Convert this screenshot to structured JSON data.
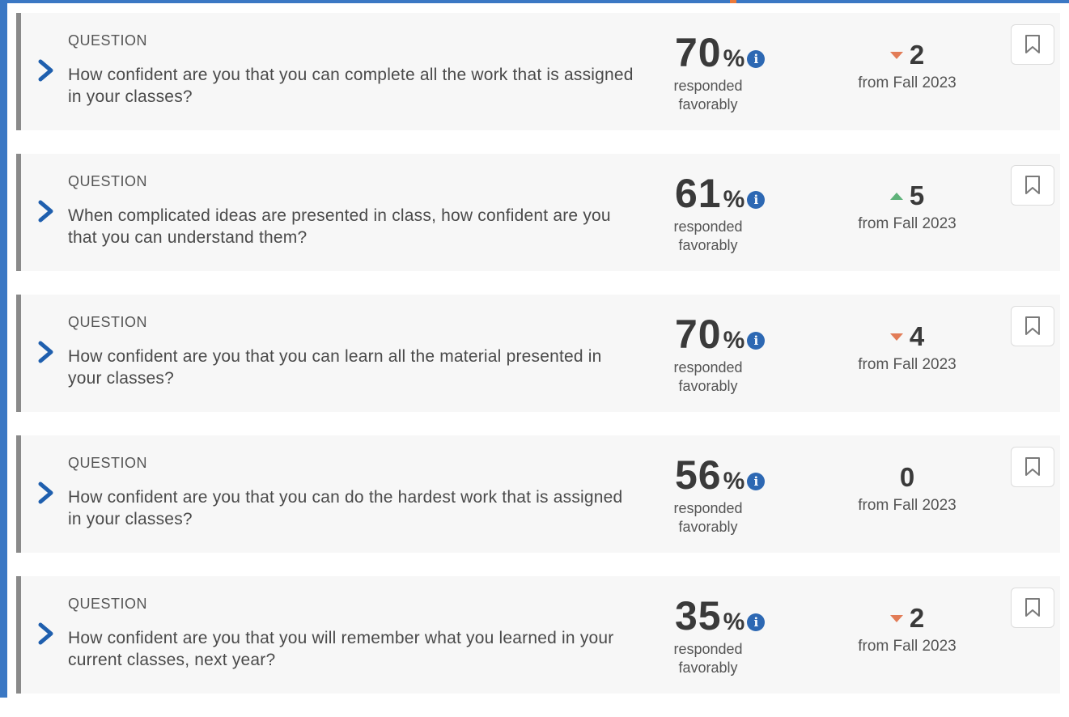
{
  "colors": {
    "frame_blue": "#3b78c4",
    "accent_orange": "#ec7a3a",
    "down": "#e27c57",
    "up": "#5fb27a",
    "info": "#2d68b3"
  },
  "icons": {
    "expand": "chevron-right-icon",
    "info": "info-icon",
    "bookmark": "bookmark-icon",
    "trend_down": "triangle-down-icon",
    "trend_up": "triangle-up-icon"
  },
  "questions": [
    {
      "label": "QUESTION",
      "text": "How confident are you that you can complete all the work that is assigned in your classes?",
      "score": "70",
      "percent": "%",
      "info": "i",
      "caption": "responded favorably",
      "change": "2",
      "direction": "down",
      "change_caption": "from Fall 2023"
    },
    {
      "label": "QUESTION",
      "text": "When complicated ideas are presented in class, how confident are you that you can understand them?",
      "score": "61",
      "percent": "%",
      "info": "i",
      "caption": "responded favorably",
      "change": "5",
      "direction": "up",
      "change_caption": "from Fall 2023"
    },
    {
      "label": "QUESTION",
      "text": "How confident are you that you can learn all the material presented in your classes?",
      "score": "70",
      "percent": "%",
      "info": "i",
      "caption": "responded favorably",
      "change": "4",
      "direction": "down",
      "change_caption": "from Fall 2023"
    },
    {
      "label": "QUESTION",
      "text": "How confident are you that you can do the hardest work that is assigned in your classes?",
      "score": "56",
      "percent": "%",
      "info": "i",
      "caption": "responded favorably",
      "change": "0",
      "direction": "none",
      "change_caption": "from Fall 2023"
    },
    {
      "label": "QUESTION",
      "text": "How confident are you that you will remember what you learned in your current classes, next year?",
      "score": "35",
      "percent": "%",
      "info": "i",
      "caption": "responded favorably",
      "change": "2",
      "direction": "down",
      "change_caption": "from Fall 2023"
    }
  ]
}
